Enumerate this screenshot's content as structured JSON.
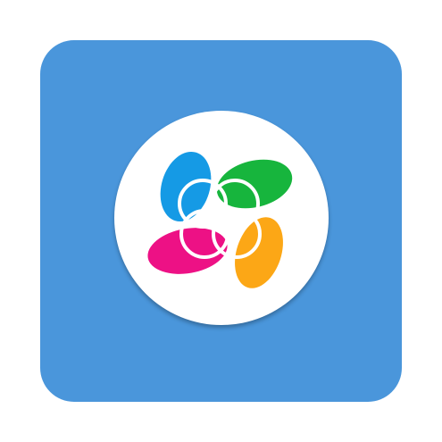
{
  "app_icon": {
    "icon_name": "ezviz-app-icon",
    "colors": {
      "tile_background": "#4a96db",
      "disc": "#ffffff",
      "petal_blue": "#159ae5",
      "petal_green": "#17b53d",
      "petal_pink": "#ed1185",
      "petal_orange": "#fca716",
      "rings": "#ffffff"
    }
  }
}
